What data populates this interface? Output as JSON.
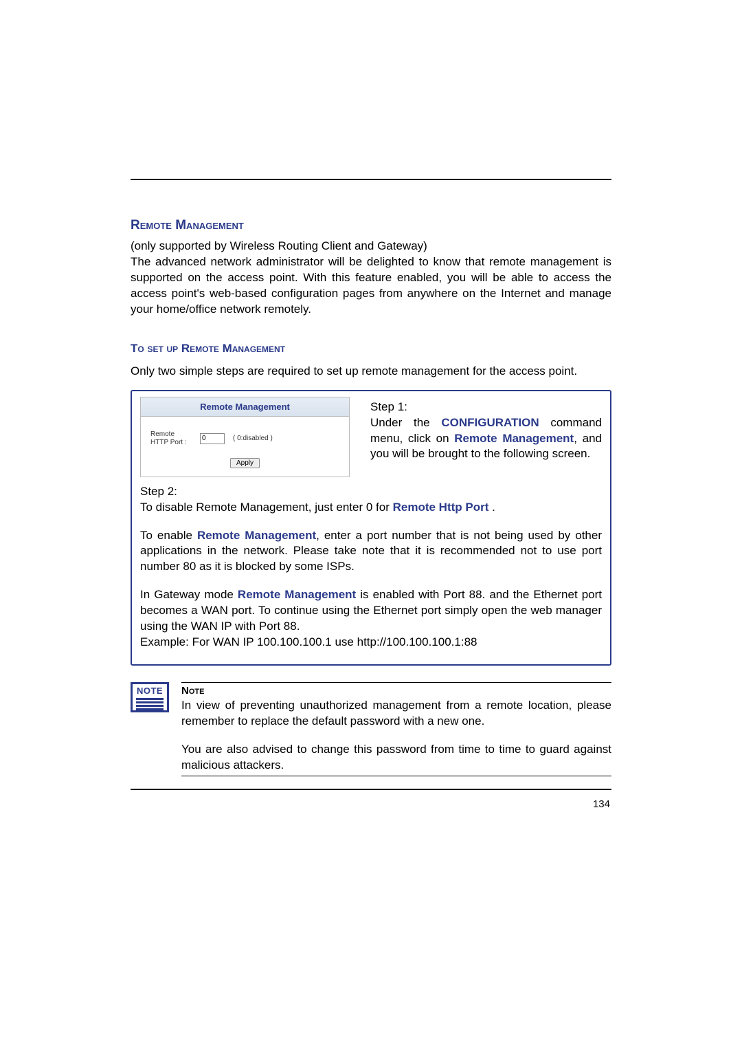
{
  "section": {
    "title": "Remote Management",
    "intro_line1": "(only supported by Wireless Routing Client and Gateway)",
    "intro_body": "The advanced network administrator will be delighted to know that remote management is supported on the access point. With this feature enabled, you will be able to access the access point's web-based configuration pages from anywhere on the Internet and manage your home/office network remotely."
  },
  "subsection": {
    "title": "To set up Remote Management",
    "intro": "Only two simple steps are required to set up remote management for the access point."
  },
  "panel": {
    "header": "Remote Management",
    "label": "Remote HTTP Port :",
    "value": "0",
    "hint": "( 0:disabled )",
    "apply": "Apply"
  },
  "step1": {
    "label": "Step 1:",
    "t1": "Under the ",
    "configuration": "CONFIGURATION",
    "t2": " command menu, click on ",
    "remote_management": "Remote Management",
    "t3": ", and you will be brought to the following screen."
  },
  "step2": {
    "label": "Step 2:",
    "line1a": "To disable Remote Management, just enter  0 for ",
    "remote_http_port": "Remote Http Port",
    "line1b": " .",
    "para2a": "To enable ",
    "para2b": ", enter a port number that is not being used by other applications in the network. Please take note that it is recommended not to use port number 80 as it is blocked by some ISPs.",
    "para3a": "In Gateway mode ",
    "para3b": " is enabled with Port 88. and the Ethernet port becomes a WAN port. To continue using the Ethernet port simply open the web manager using the WAN IP with Port 88.",
    "para3c": "Example: For WAN IP 100.100.100.1 use http://100.100.100.1:88"
  },
  "note": {
    "icon_label": "NOTE",
    "header": "Note",
    "p1": "In view of preventing unauthorized management from a remote location, please remember to replace the default password with a new one.",
    "p2": "You are also advised to change this password from time to time to guard against malicious attackers."
  },
  "page_number": "134"
}
